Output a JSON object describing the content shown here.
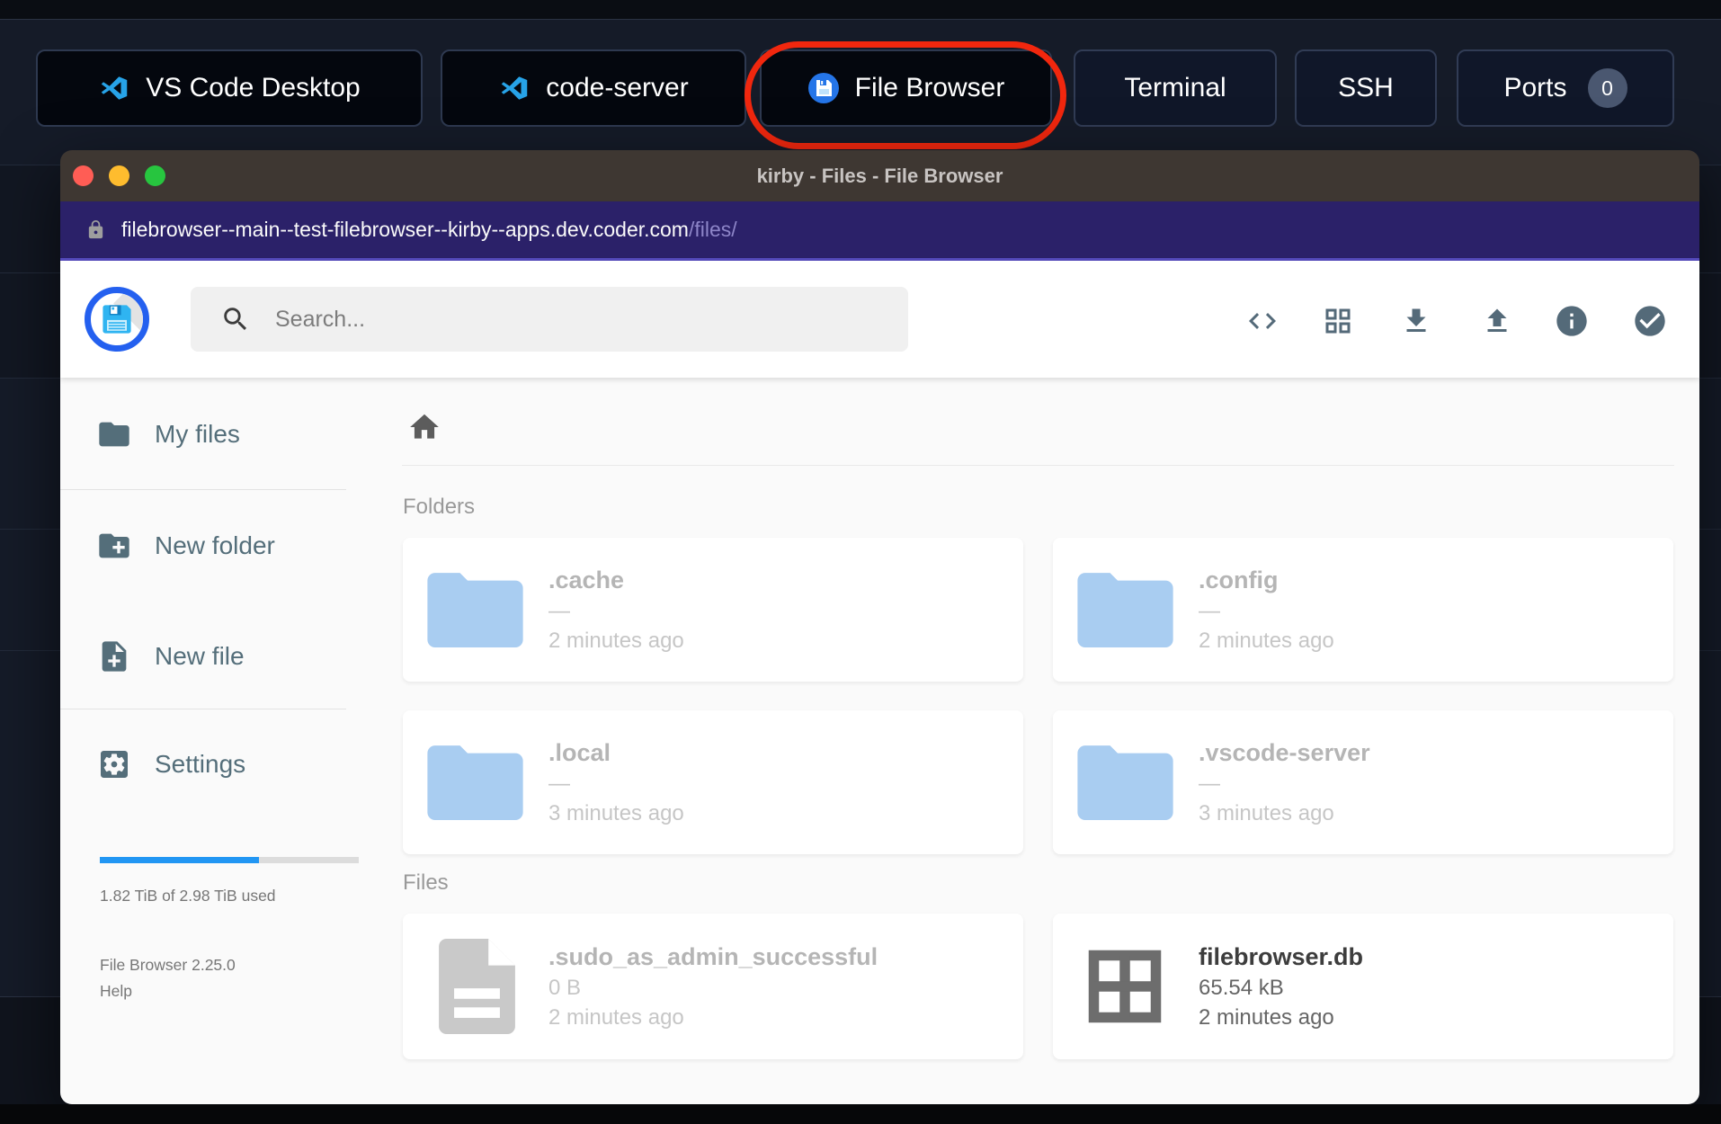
{
  "top_bar": {
    "buttons": [
      {
        "label": "VS Code Desktop",
        "icon": "vscode-logo"
      },
      {
        "label": "code-server",
        "icon": "vscode-logo"
      },
      {
        "label": "File Browser",
        "icon": "filebrowser-logo"
      },
      {
        "label": "Terminal"
      },
      {
        "label": "SSH"
      },
      {
        "label": "Ports",
        "badge": "0"
      }
    ],
    "annotation_color": "#f1270e"
  },
  "window": {
    "title": "kirby - Files - File Browser",
    "url": {
      "host": "filebrowser--main--test-filebrowser--kirby--apps.dev.coder.com",
      "path": "/files/"
    }
  },
  "header": {
    "search_placeholder": "Search...",
    "icons": [
      "code-icon",
      "grid-view-icon",
      "download-icon",
      "upload-icon",
      "info-icon",
      "check-circle-icon"
    ]
  },
  "sidebar": {
    "items": [
      {
        "label": "My files",
        "icon": "folder-icon"
      },
      {
        "label": "New folder",
        "icon": "folder-plus-icon"
      },
      {
        "label": "New file",
        "icon": "file-plus-icon"
      },
      {
        "label": "Settings",
        "icon": "gear-icon"
      }
    ],
    "storage": {
      "usage_text": "1.82 TiB of 2.98 TiB used",
      "percent": 61.5,
      "bar_color": "#2196f3"
    },
    "version": "File Browser 2.25.0",
    "help": "Help"
  },
  "content": {
    "folders_label": "Folders",
    "files_label": "Files",
    "folders": [
      {
        "name": ".cache",
        "size": "—",
        "modified": "2 minutes ago"
      },
      {
        "name": ".config",
        "size": "—",
        "modified": "2 minutes ago"
      },
      {
        "name": ".local",
        "size": "—",
        "modified": "3 minutes ago"
      },
      {
        "name": ".vscode-server",
        "size": "—",
        "modified": "3 minutes ago"
      }
    ],
    "files": [
      {
        "name": ".sudo_as_admin_successful",
        "size": "0 B",
        "modified": "2 minutes ago"
      },
      {
        "name": "filebrowser.db",
        "size": "65.54 kB",
        "modified": "2 minutes ago"
      }
    ]
  },
  "colors": {
    "accent_blue": "#2196f3",
    "folder_blue": "#a9cdf1",
    "annotation_red": "#f1270e"
  }
}
